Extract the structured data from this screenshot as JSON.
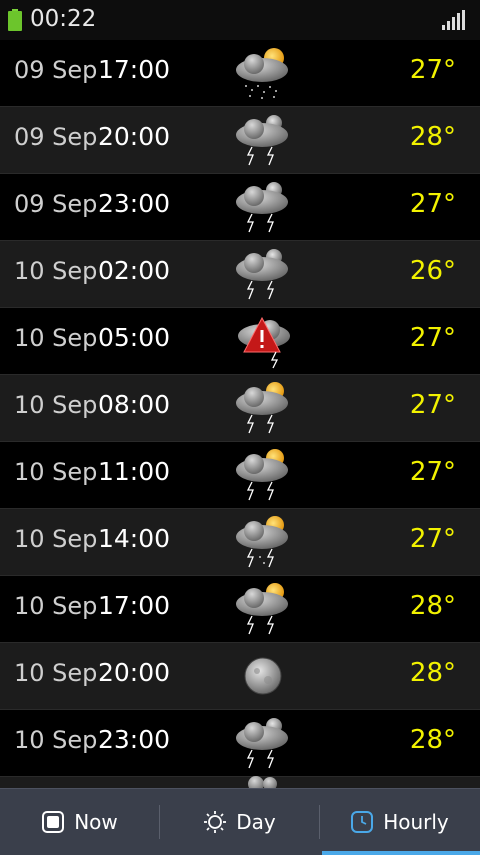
{
  "status_bar": {
    "time": "00:22"
  },
  "rows": [
    {
      "date": "09 Sep",
      "time": "17:00",
      "temp": "27°",
      "icon": "rain-sun-cloud-icon"
    },
    {
      "date": "09 Sep",
      "time": "20:00",
      "temp": "28°",
      "icon": "thunderstorm-moon-icon"
    },
    {
      "date": "09 Sep",
      "time": "23:00",
      "temp": "27°",
      "icon": "thunderstorm-moon-icon"
    },
    {
      "date": "10 Sep",
      "time": "02:00",
      "temp": "26°",
      "icon": "thunderstorm-moon-icon"
    },
    {
      "date": "10 Sep",
      "time": "05:00",
      "temp": "27°",
      "icon": "severe-warning-storm-icon"
    },
    {
      "date": "10 Sep",
      "time": "08:00",
      "temp": "27°",
      "icon": "thunderstorm-sun-icon"
    },
    {
      "date": "10 Sep",
      "time": "11:00",
      "temp": "27°",
      "icon": "thunderstorm-sun-icon"
    },
    {
      "date": "10 Sep",
      "time": "14:00",
      "temp": "27°",
      "icon": "thunderstorm-sun-icon"
    },
    {
      "date": "10 Sep",
      "time": "17:00",
      "temp": "28°",
      "icon": "thunderstorm-sun-icon"
    },
    {
      "date": "10 Sep",
      "time": "20:00",
      "temp": "28°",
      "icon": "moon-icon"
    },
    {
      "date": "10 Sep",
      "time": "23:00",
      "temp": "28°",
      "icon": "thunderstorm-moon-icon"
    }
  ],
  "tabs": [
    {
      "label": "Now",
      "icon": "now-square-icon"
    },
    {
      "label": "Day",
      "icon": "sun-outline-icon"
    },
    {
      "label": "Hourly",
      "icon": "clock-icon",
      "active": true
    }
  ],
  "colors": {
    "temperature": "#f2f200",
    "active_tab": "#4aa8e8",
    "navbar": "#3a3f4b"
  }
}
